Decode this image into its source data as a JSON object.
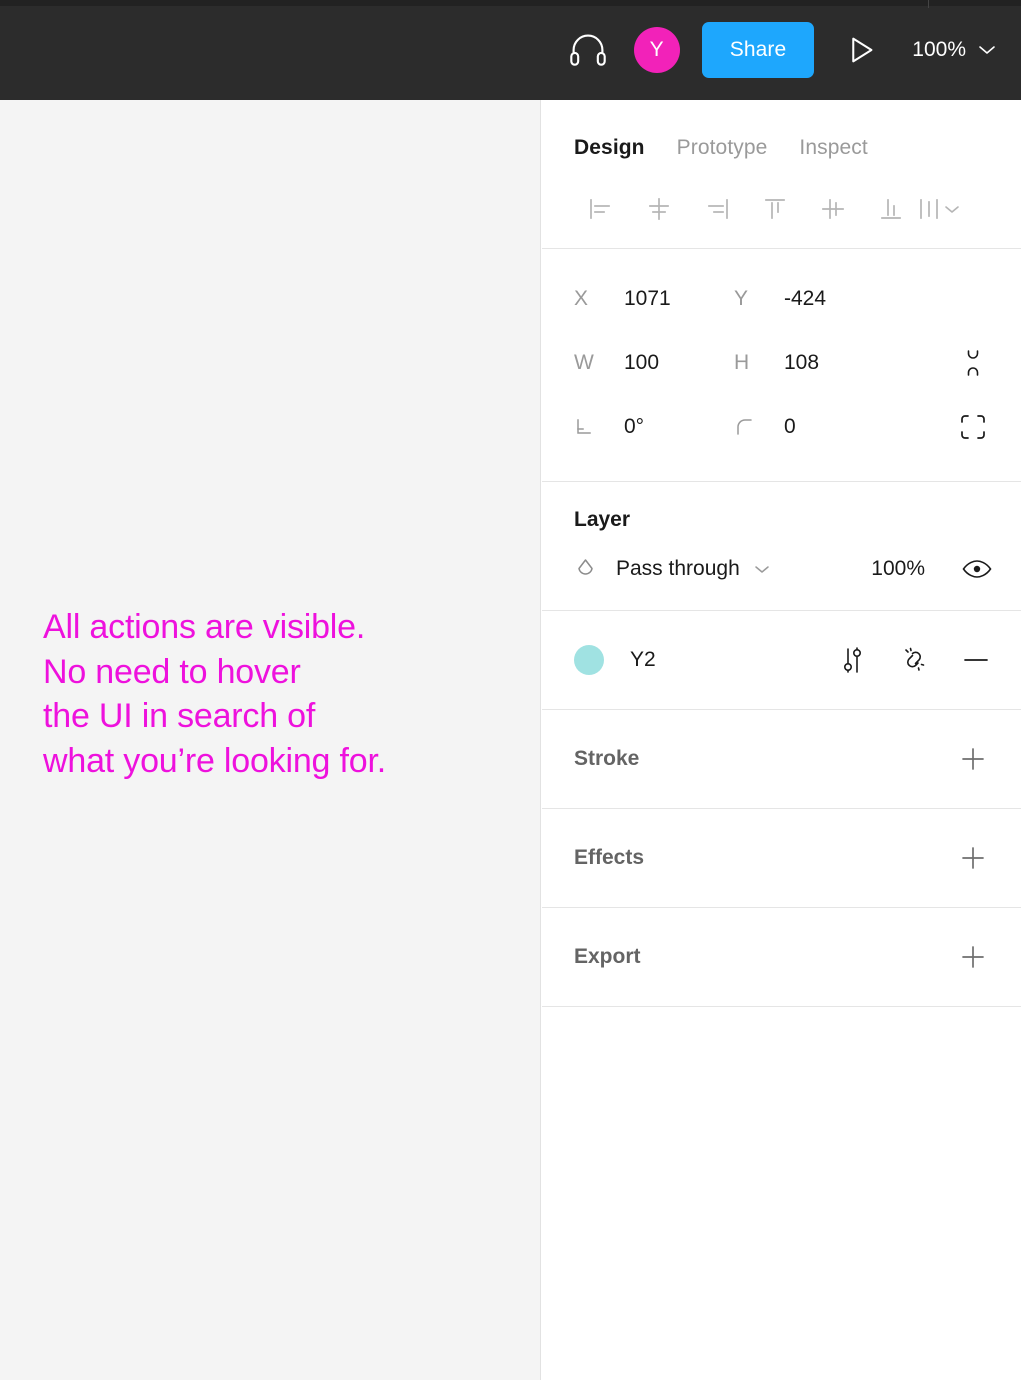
{
  "topbar": {
    "headphones_icon": "headphones-icon",
    "avatar_initial": "Y",
    "avatar_color": "#f222b9",
    "share_label": "Share",
    "share_color": "#1ea7fd",
    "present_icon": "play-icon",
    "zoom_level": "100%",
    "zoom_caret_icon": "chevron-down-icon",
    "background": "#2c2c2c"
  },
  "canvas": {
    "background": "#f4f4f4",
    "note_text": "All actions are visible.\nNo need to hover\nthe UI in search of\nwhat you’re looking for.",
    "note_color": "#ee11dd"
  },
  "panel": {
    "tabs": [
      {
        "label": "Design",
        "active": true
      },
      {
        "label": "Prototype",
        "active": false
      },
      {
        "label": "Inspect",
        "active": false
      }
    ],
    "align_buttons": [
      {
        "name": "align-left-icon"
      },
      {
        "name": "align-horizontal-centers-icon"
      },
      {
        "name": "align-right-icon"
      },
      {
        "name": "align-top-icon"
      },
      {
        "name": "align-vertical-centers-icon"
      },
      {
        "name": "align-bottom-icon"
      }
    ],
    "align_more_icon": "distribute-more-chevron-icon",
    "properties": [
      {
        "label": "X",
        "value": "1071",
        "label2": "Y",
        "value2": "-424",
        "side_icon": ""
      },
      {
        "label": "W",
        "value": "100",
        "label2": "H",
        "value2": "108",
        "side_icon": "proportion-unlock-icon"
      },
      {
        "label": "rotation-icon",
        "value": "0°",
        "label2": "corner-radius-icon",
        "value2": "0",
        "side_icon": "independent-corners-icon"
      }
    ],
    "layer": {
      "title": "Layer",
      "blend_icon": "blend-mode-icon",
      "blend_mode": "Pass through",
      "blend_caret_icon": "chevron-down-icon",
      "opacity": "100%",
      "visibility_icon": "eye-icon"
    },
    "fill": {
      "swatch_color": "#a0e2e2",
      "name": "Y2",
      "actions": [
        {
          "name": "tune-sliders-icon"
        },
        {
          "name": "detach-style-icon"
        },
        {
          "name": "remove-minus-icon"
        }
      ]
    },
    "sections": [
      {
        "title": "Stroke",
        "add_icon": "plus-icon"
      },
      {
        "title": "Effects",
        "add_icon": "plus-icon"
      },
      {
        "title": "Export",
        "add_icon": "plus-icon"
      }
    ]
  }
}
